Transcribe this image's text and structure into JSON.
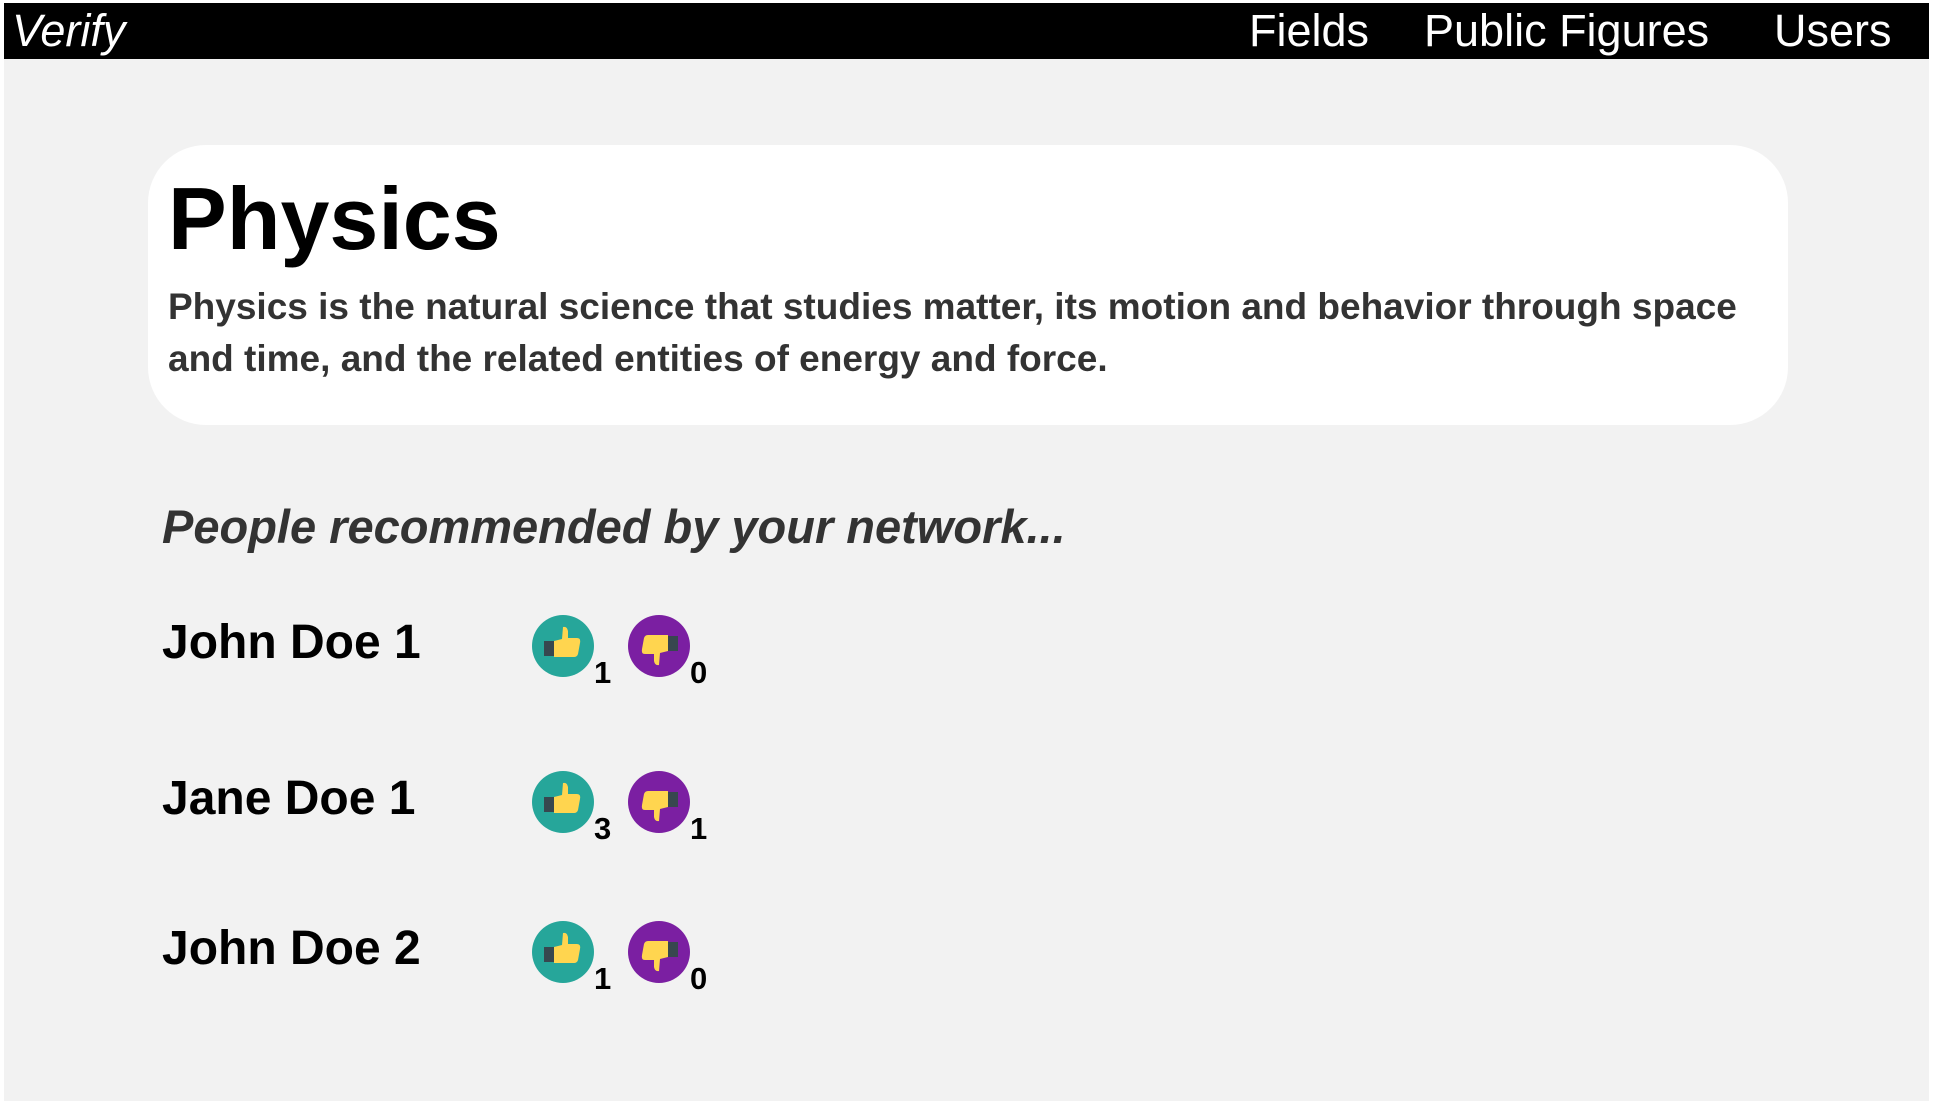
{
  "navbar": {
    "brand": "Verify",
    "links": [
      "Fields",
      "Public Figures",
      "Users"
    ]
  },
  "field": {
    "title": "Physics",
    "description": "Physics is the natural science that studies matter, its motion and behavior through space and time, and the related entities of energy and force."
  },
  "recommendations": {
    "heading": "People recommended by your network...",
    "people": [
      {
        "name": "John Doe 1",
        "upvotes": "1",
        "downvotes": "0"
      },
      {
        "name": "Jane Doe 1",
        "upvotes": "3",
        "downvotes": "1"
      },
      {
        "name": "John Doe 2",
        "upvotes": "1",
        "downvotes": "0"
      }
    ]
  },
  "icons": {
    "upvote": "thumbs-up-icon",
    "downvote": "thumbs-down-icon"
  },
  "colors": {
    "navbar_bg": "#000000",
    "page_bg": "#f2f2f2",
    "card_bg": "#ffffff",
    "upvote_circle": "#26a69a",
    "downvote_circle": "#7b1fa2",
    "thumb": "#ffd54f",
    "cuff": "#37474f"
  }
}
